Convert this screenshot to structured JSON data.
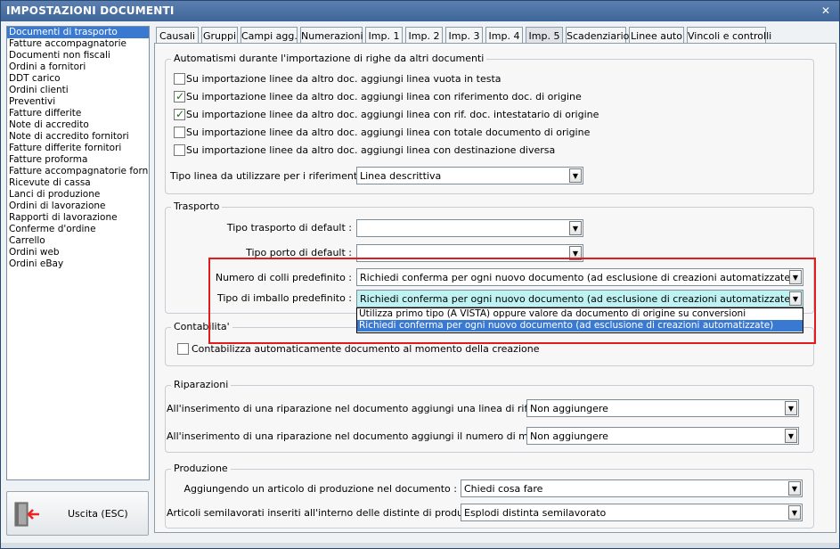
{
  "window": {
    "title": "IMPOSTAZIONI DOCUMENTI",
    "close_glyph": "✕"
  },
  "doc_list": [
    "Documenti di trasporto",
    "Fatture accompagnatorie",
    "Documenti non fiscali",
    "Ordini a fornitori",
    "DDT carico",
    "Ordini clienti",
    "Preventivi",
    "Fatture differite",
    "Note di accredito",
    "Note di accredito fornitori",
    "Fatture differite fornitori",
    "Fatture proforma",
    "Fatture accompagnatorie fornito",
    "Ricevute di cassa",
    "Lanci di produzione",
    "Ordini di lavorazione",
    "Rapporti di lavorazione",
    "Conferme d'ordine",
    "Carrello",
    "Ordini web",
    "Ordini eBay"
  ],
  "selected_doc_index": 0,
  "exit_button": {
    "label": "Uscita (ESC)",
    "icon": "exit-door-icon"
  },
  "tabs": [
    "Causali",
    "Gruppi",
    "Campi agg.",
    "Numerazioni",
    "Imp. 1",
    "Imp. 2",
    "Imp. 3",
    "Imp. 4",
    "Imp. 5",
    "Scadenziario",
    "Linee auto",
    "Vincoli e controlli"
  ],
  "active_tab": "Imp. 5",
  "automatismi": {
    "title": "Automatismi durante l'importazione di righe da altri documenti",
    "checks": [
      {
        "label": "Su importazione linee da altro doc. aggiungi linea vuota in testa",
        "checked": false
      },
      {
        "label": "Su importazione linee da altro doc. aggiungi linea con riferimento doc. di origine",
        "checked": true
      },
      {
        "label": "Su importazione linee da altro doc. aggiungi linea con rif. doc. intestatario di origine",
        "checked": true
      },
      {
        "label": "Su importazione linee da altro doc. aggiungi linea con totale documento di origine",
        "checked": false
      },
      {
        "label": "Su importazione linee da altro doc. aggiungi linea con destinazione diversa",
        "checked": false
      }
    ],
    "tipo_linea_label": "Tipo linea da utilizzare per i riferimenti :",
    "tipo_linea_value": "Linea descrittiva"
  },
  "trasporto": {
    "title": "Trasporto",
    "tipo_trasporto_label": "Tipo trasporto di default :",
    "tipo_trasporto_value": "",
    "tipo_porto_label": "Tipo porto di default :",
    "tipo_porto_value": "",
    "colli_label": "Numero di colli predefinito :",
    "colli_value": "Richiedi conferma per ogni nuovo documento (ad esclusione di creazioni automatizzate)",
    "imballo_label": "Tipo di imballo predefinito :",
    "imballo_value": "Richiedi conferma per ogni nuovo documento (ad esclusione di creazioni automatizzate)",
    "imballo_options": [
      "Utilizza primo tipo (A VISTA) oppure valore da documento di origine su conversioni",
      "Richiedi conferma per ogni nuovo documento (ad esclusione di creazioni automatizzate)"
    ],
    "imballo_selected_option": 1
  },
  "contabilita": {
    "title": "Contabilita'",
    "check_label": "Contabilizza automaticamente documento al momento della creazione",
    "checked": false
  },
  "riparazioni": {
    "title": "Riparazioni",
    "linea_label": "All'inserimento di una riparazione nel documento aggiungi una linea di riferimento :",
    "linea_value": "Non aggiungere",
    "matricola_label": "All'inserimento di una riparazione nel documento aggiungi il numero di matricola :",
    "matricola_value": "Non aggiungere"
  },
  "produzione": {
    "title": "Produzione",
    "articolo_label": "Aggiungendo un articolo di produzione nel documento :",
    "articolo_value": "Chiedi cosa fare",
    "semilavorati_label": "Articoli semilavorati inseriti all'interno delle distinte di produzione :",
    "semilavorati_value": "Esplodi distinta semilavorato"
  },
  "colors": {
    "title_bar": "#4a71a5",
    "selection": "#3a79d2",
    "highlight_box": "#e21c1c",
    "combo_focus": "#bff2f2"
  }
}
